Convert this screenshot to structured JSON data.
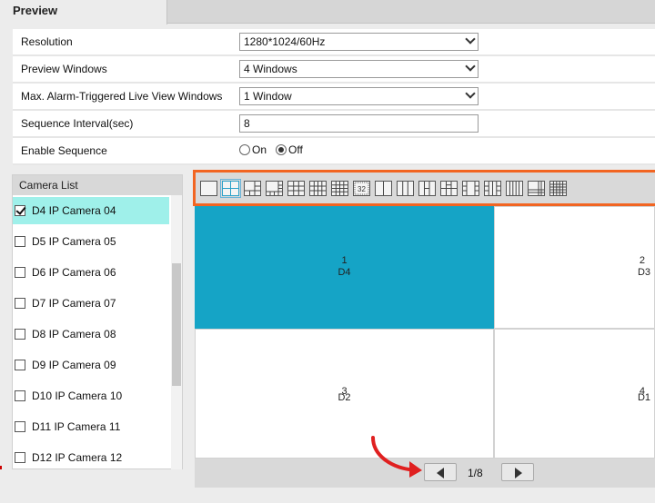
{
  "tab": {
    "title": "Preview"
  },
  "settings": {
    "resolution": {
      "label": "Resolution",
      "value": "1280*1024/60Hz"
    },
    "preview_windows": {
      "label": "Preview Windows",
      "value": "4 Windows"
    },
    "alarm_live_view": {
      "label": "Max. Alarm-Triggered Live View Windows",
      "value": "1 Window"
    },
    "sequence_interval": {
      "label": "Sequence Interval(sec)",
      "value": "8"
    },
    "enable_sequence": {
      "label": "Enable Sequence",
      "on_label": "On",
      "off_label": "Off",
      "selected": "Off"
    }
  },
  "camera_list": {
    "header": "Camera List",
    "items": [
      {
        "label": "D4 IP Camera 04",
        "checked": true
      },
      {
        "label": "D5 IP Camera 05",
        "checked": false
      },
      {
        "label": "D6 IP Camera 06",
        "checked": false
      },
      {
        "label": "D7 IP Camera 07",
        "checked": false
      },
      {
        "label": "D8 IP Camera 08",
        "checked": false
      },
      {
        "label": "D9 IP Camera 09",
        "checked": false
      },
      {
        "label": "D10 IP Camera 10",
        "checked": false
      },
      {
        "label": "D11 IP Camera 11",
        "checked": false
      },
      {
        "label": "D12 IP Camera 12",
        "checked": false
      }
    ]
  },
  "layout_toolbar": {
    "buttons": [
      "1",
      "4",
      "6",
      "8",
      "9",
      "10",
      "16",
      "32",
      "2",
      "3",
      "7a",
      "13",
      "7b",
      "14",
      "15",
      "12",
      "25"
    ],
    "custom_32_label": "32",
    "highlight_color": "#f26522"
  },
  "video_grid": {
    "cells": [
      {
        "number": "1",
        "device": "D4",
        "active": true
      },
      {
        "number": "2",
        "device": "D3",
        "active": false
      },
      {
        "number": "3",
        "device": "D2",
        "active": false
      },
      {
        "number": "4",
        "device": "D1",
        "active": false
      }
    ],
    "active_color": "#15a4c6"
  },
  "pager": {
    "page_text": "1/8"
  }
}
